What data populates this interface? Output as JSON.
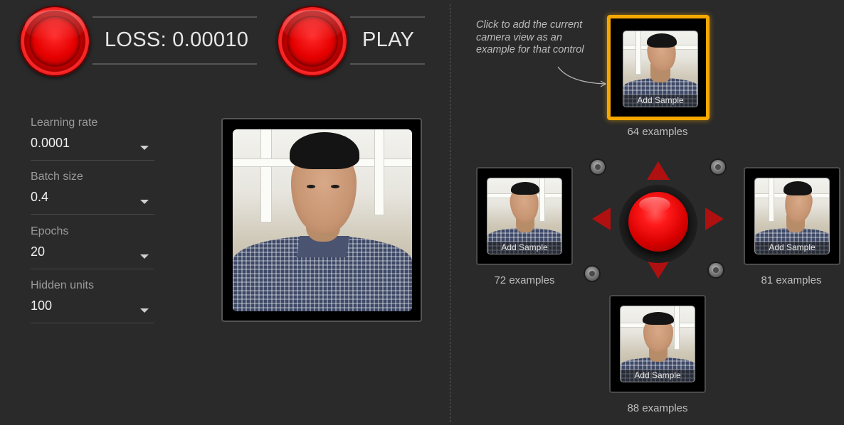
{
  "header": {
    "loss_label": "LOSS: 0.00010",
    "play_label": "PLAY"
  },
  "controls": [
    {
      "label": "Learning rate",
      "value": "0.0001"
    },
    {
      "label": "Batch size",
      "value": "0.4"
    },
    {
      "label": "Epochs",
      "value": "20"
    },
    {
      "label": "Hidden units",
      "value": "100"
    }
  ],
  "hint": {
    "text": "Click to add the current camera view as an example for that control"
  },
  "samples": {
    "up": {
      "button": "Add Sample",
      "count": "64 examples"
    },
    "left": {
      "button": "Add Sample",
      "count": "72 examples"
    },
    "right": {
      "button": "Add Sample",
      "count": "81 examples"
    },
    "down": {
      "button": "Add Sample",
      "count": "88 examples"
    }
  },
  "icons": {
    "train_button": "red-record-button-icon",
    "play_button": "red-record-button-icon",
    "dropdown": "chevron-down-icon",
    "direction_up": "arrow-up-icon",
    "direction_down": "arrow-down-icon",
    "direction_left": "arrow-left-icon",
    "direction_right": "arrow-right-icon",
    "controller_center": "red-joystick-button-icon"
  },
  "colors": {
    "background": "#2a2a2a",
    "accent_red": "#e00000",
    "selected_border": "#f5a800"
  }
}
